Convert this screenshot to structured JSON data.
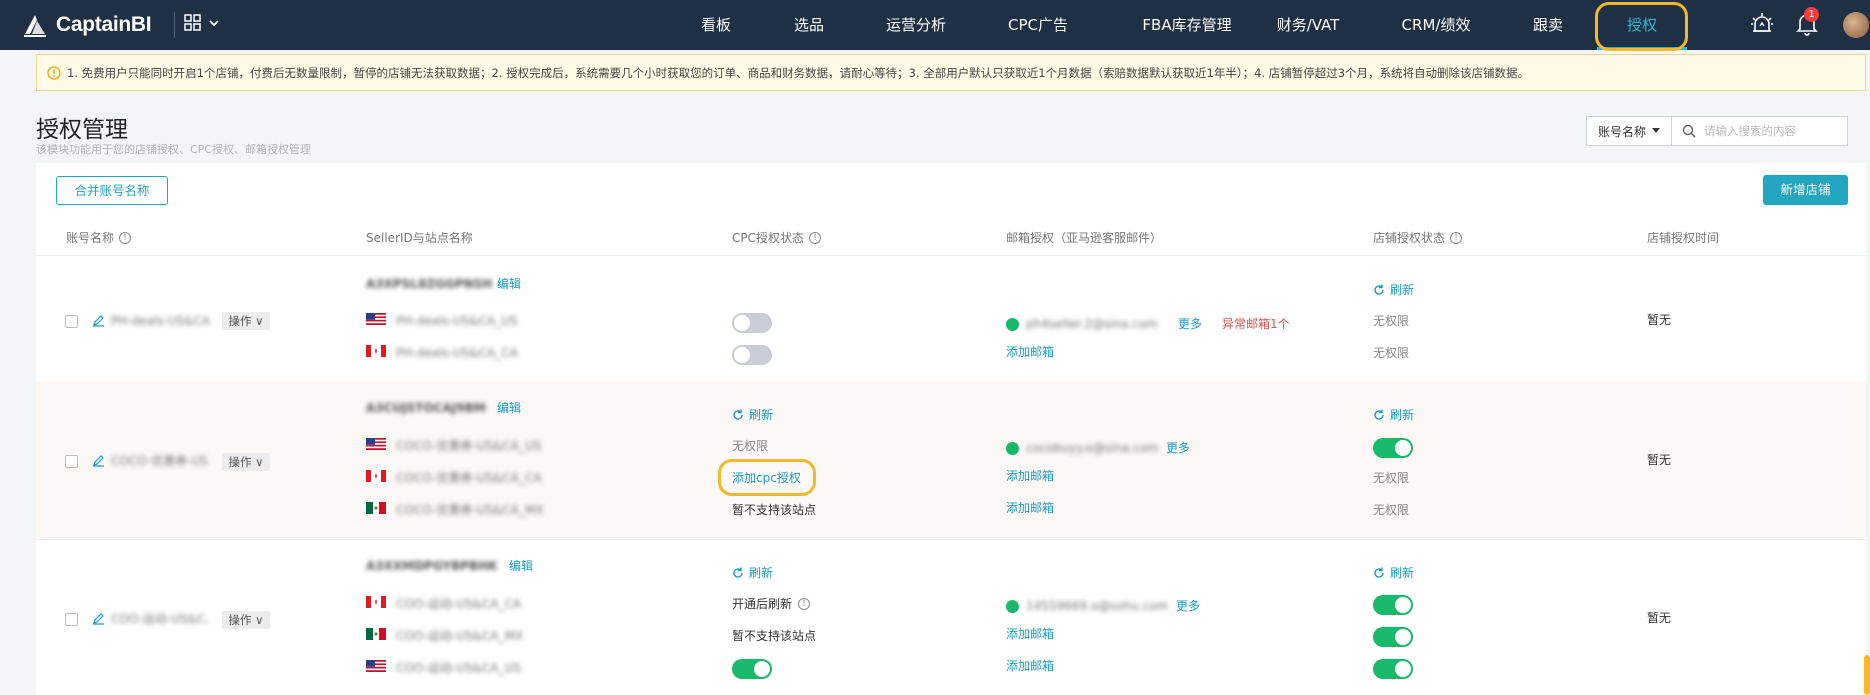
{
  "header": {
    "brand": "CaptainBI",
    "nav": [
      "看板",
      "选品",
      "运营分析",
      "CPC广告",
      "FBA库存管理",
      "财务/VAT",
      "CRM/绩效",
      "跟卖",
      "授权"
    ],
    "active_nav": "授权",
    "notification_count": "1"
  },
  "notice": {
    "text": "1. 免费用户只能同时开启1个店铺，付费后无数量限制，暂停的店铺无法获取数据；2. 授权完成后，系统需要几个小时获取您的订单、商品和财务数据，请耐心等待；3. 全部用户默认只获取近1个月数据（索赔数据默认获取近1年半）；4. 店铺暂停超过3个月，系统将自动删除该店铺数据。"
  },
  "page": {
    "title": "授权管理",
    "subtitle": "该模块功能用于您的店铺授权、CPC授权、邮箱授权管理"
  },
  "search": {
    "select_label": "账号名称",
    "placeholder": "请输入搜索的内容"
  },
  "toolbar": {
    "merge_label": "合并账号名称",
    "add_store_label": "新增店铺"
  },
  "table": {
    "headers": [
      "账号名称",
      "SellerID与站点名称",
      "CPC授权状态",
      "邮箱授权（亚马逊客服邮件）",
      "店铺授权状态",
      "店铺授权时间"
    ],
    "op_label": "操作",
    "edit_label": "编辑",
    "refresh_label": "刷新",
    "more_label": "更多",
    "add_email_label": "添加邮箱",
    "rows": [
      {
        "account": "PH-deals-US&CA",
        "seller_id": "A3XPSL8ZGGPNSH",
        "sites": [
          "PH-deals-US&CA_US",
          "PH-deals-US&CA_CA"
        ],
        "flags": [
          "us",
          "ca"
        ],
        "cpc": [
          {
            "kind": "toggle",
            "on": false
          },
          {
            "kind": "toggle",
            "on": false
          }
        ],
        "email_address": "ph4seller.2@sina.com",
        "email_abnormal": "异常邮箱1个",
        "store_status": [
          "无权限",
          "无权限"
        ],
        "auth_time": "暂无"
      },
      {
        "account": "COCO-优惠券-US&CA",
        "seller_id": "A3CUJSTOCAJ9BM",
        "sites": [
          "COCO-优惠券-US&CA_US",
          "COCO-优惠券-US&CA_CA",
          "COCO-优惠券-US&CA_MX"
        ],
        "flags": [
          "us",
          "ca",
          "mx"
        ],
        "cpc": [
          {
            "kind": "text",
            "text": "无权限"
          },
          {
            "kind": "link",
            "text": "添加cpc授权"
          },
          {
            "kind": "text",
            "text": "暂不支持该站点"
          }
        ],
        "email_address": "cocobuyy.o@sina.com",
        "store_status": [
          {
            "kind": "toggle",
            "on": true
          },
          {
            "kind": "text",
            "text": "无权限"
          },
          {
            "kind": "text",
            "text": "无权限"
          }
        ],
        "auth_time": "暂无"
      },
      {
        "account": "COO-运动-US&CA",
        "seller_id": "A3XXMDPGYBPBHK",
        "sites": [
          "COO-运动-US&CA_CA",
          "COO-运动-US&CA_MX",
          "COO-运动-US&CA_US"
        ],
        "flags": [
          "ca",
          "mx",
          "us"
        ],
        "cpc": [
          {
            "kind": "text",
            "text": "开通后刷新"
          },
          {
            "kind": "text",
            "text": "暂不支持该站点"
          },
          {
            "kind": "toggle",
            "on": true
          }
        ],
        "email_address": "14559669.o@sohu.com",
        "store_status": [
          {
            "kind": "toggle",
            "on": true
          },
          {
            "kind": "toggle",
            "on": true
          },
          {
            "kind": "toggle",
            "on": true
          }
        ],
        "auth_time": "暂无"
      }
    ]
  },
  "colors": {
    "topbar": "#1f3044",
    "accent": "#23a6bf",
    "toggle_on": "#18b96b",
    "highlight": "#f5b82a"
  }
}
